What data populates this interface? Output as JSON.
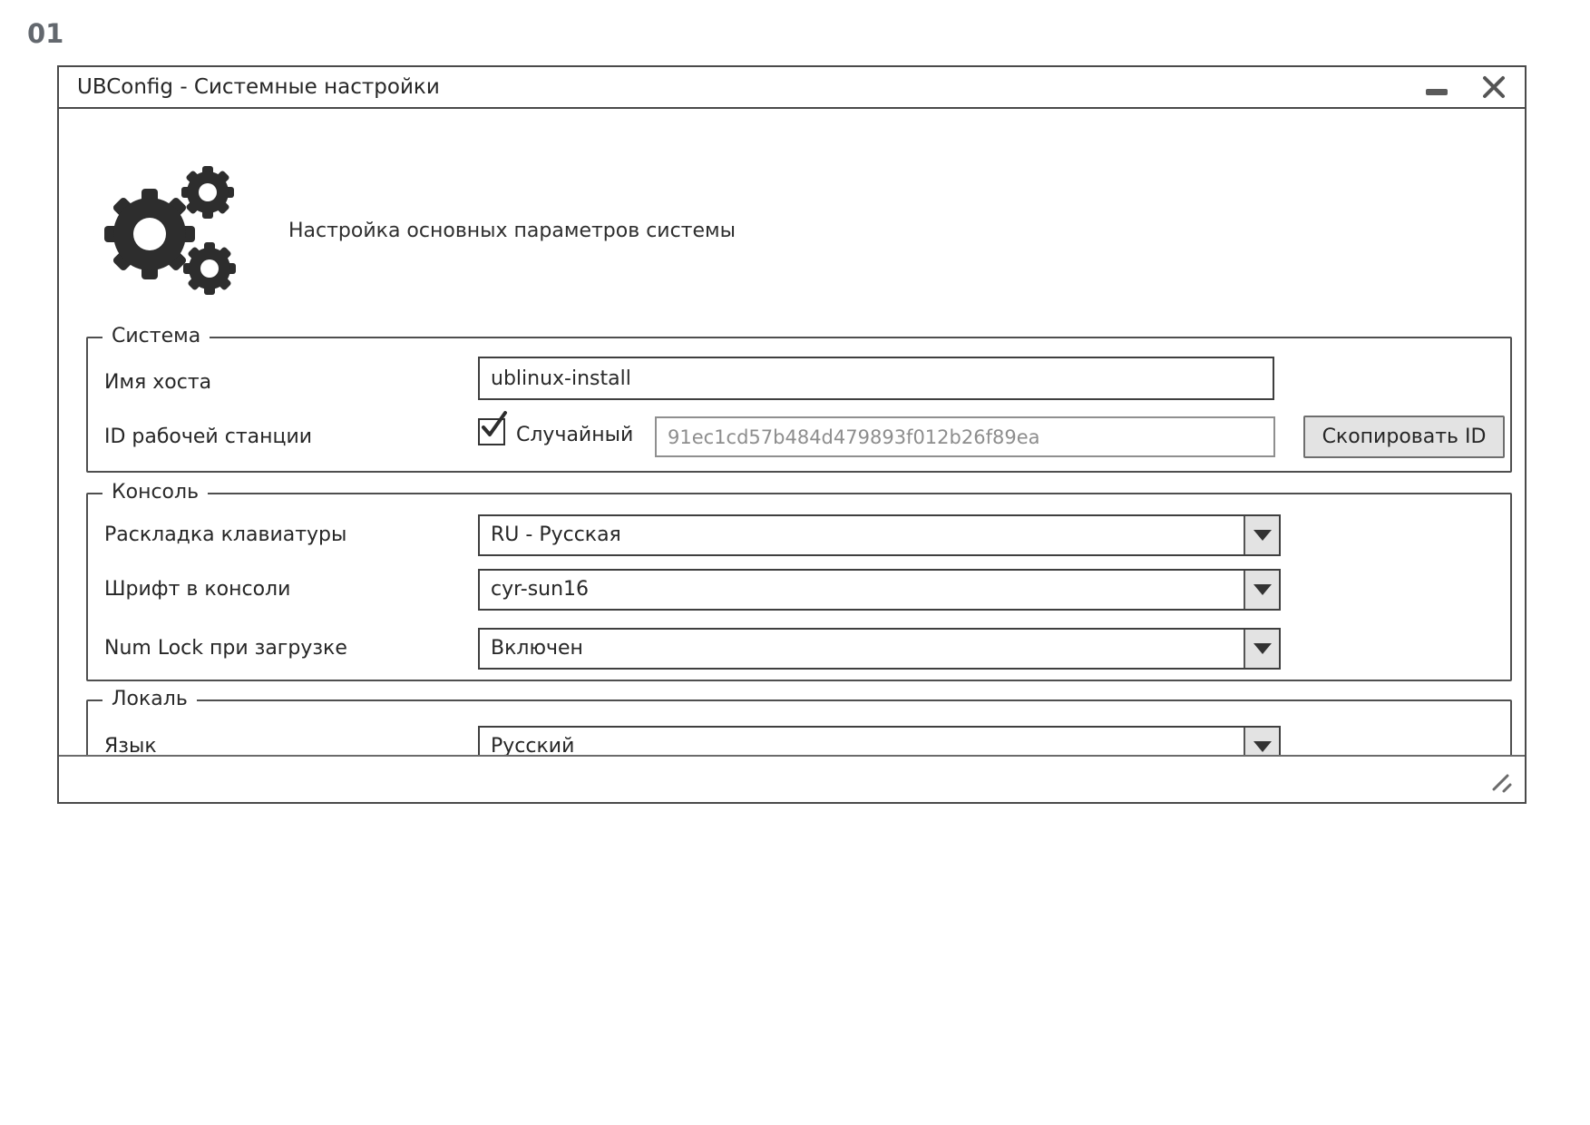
{
  "page": {
    "label": "01"
  },
  "window": {
    "title": "UBConfig - Системные настройки",
    "controls": {
      "minimize_icon": "minimize-icon",
      "close_icon": "close-icon"
    },
    "header": {
      "icon": "gears-icon",
      "description": "Настройка основных параметров системы"
    },
    "groups": {
      "system": {
        "legend": "Система",
        "hostname": {
          "label": "Имя хоста",
          "value": "ublinux-install"
        },
        "station_id": {
          "label": "ID рабочей станции",
          "random_checkbox": {
            "label": "Случайный",
            "checked": true,
            "icon": "checkmark-icon"
          },
          "value": "91ec1cd57b484d479893f012b26f89ea",
          "copy_button_label": "Скопировать ID"
        }
      },
      "console": {
        "legend": "Консоль",
        "fields": [
          {
            "label": "Раскладка клавиатуры",
            "value": "RU - Русская"
          },
          {
            "label": "Шрифт в консоли",
            "value": "cyr-sun16"
          },
          {
            "label": "Num Lock при загрузке",
            "value": "Включен"
          }
        ]
      },
      "locale": {
        "legend": "Локаль",
        "fields": [
          {
            "label": "Язык",
            "value": "Русский"
          }
        ]
      }
    },
    "statusbar": {
      "resize_icon": "resize-grip-icon"
    }
  },
  "colors": {
    "window_border": "#4a4a4a",
    "button_bg": "#e3e3e3",
    "id_text": "#8d8d8d",
    "page_label": "#63686e",
    "icon_dark": "#2d2d2d"
  }
}
